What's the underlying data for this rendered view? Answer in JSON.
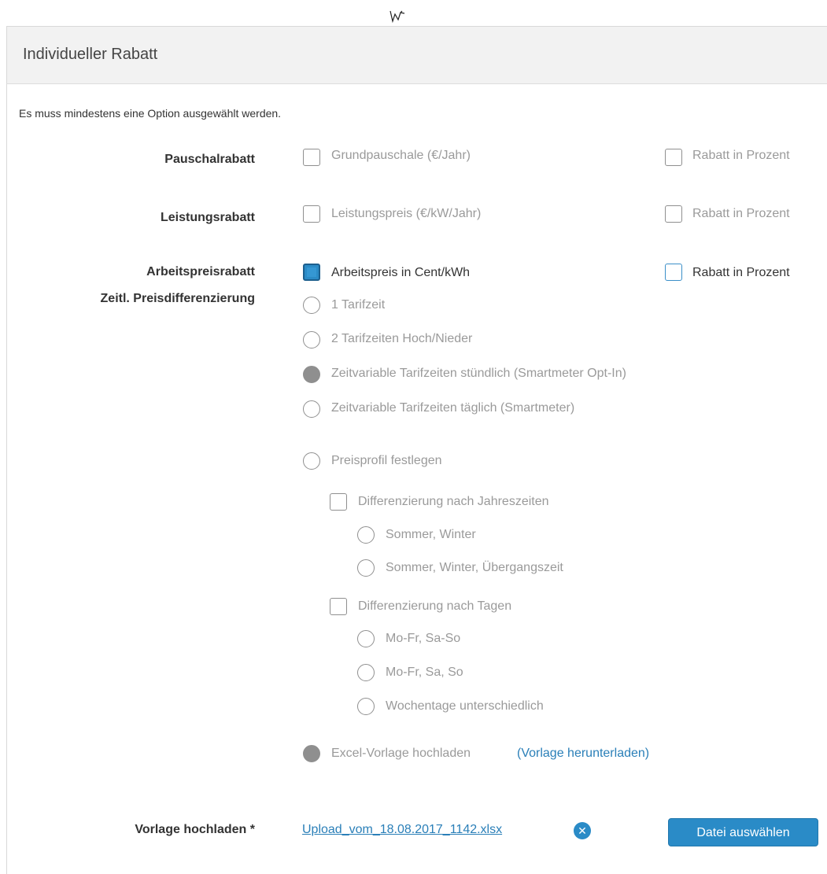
{
  "panel": {
    "title": "Individueller Rabatt",
    "note": "Es muss mindestens eine Option ausgewählt werden."
  },
  "pauschal": {
    "label": "Pauschalrabatt",
    "option1": "Grundpauschale (€/Jahr)",
    "option2": "Rabatt in Prozent"
  },
  "leistung": {
    "label": "Leistungsrabatt",
    "option1": "Leistungspreis (€/kW/Jahr)",
    "option2": "Rabatt in Prozent"
  },
  "arbeitspreis": {
    "label": "Arbeitspreisrabatt",
    "option1": "Arbeitspreis in Cent/kWh",
    "option2": "Rabatt in Prozent"
  },
  "zeitl": {
    "label": "Zeitl. Preisdifferenzierung",
    "options": [
      "1 Tarifzeit",
      "2 Tarifzeiten Hoch/Nieder",
      "Zeitvariable Tarifzeiten stündlich (Smartmeter Opt-In)",
      "Zeitvariable Tarifzeiten täglich (Smartmeter)",
      "Preisprofil festlegen"
    ],
    "jahreszeiten": {
      "label": "Differenzierung nach Jahreszeiten",
      "options": [
        "Sommer, Winter",
        "Sommer, Winter, Übergangszeit"
      ]
    },
    "tage": {
      "label": "Differenzierung nach Tagen",
      "options": [
        "Mo-Fr, Sa-So",
        "Mo-Fr, Sa, So",
        "Wochentage unterschiedlich"
      ]
    },
    "excel": {
      "label": "Excel-Vorlage hochladen",
      "link": "(Vorlage herunterladen)"
    }
  },
  "upload": {
    "label": "Vorlage hochladen *",
    "filename": "Upload_vom_18.08.2017_1142.xlsx",
    "button": "Datei auswählen"
  },
  "icons": {
    "remove": "close-circle-icon",
    "cursor": "mouse-cursor-icon"
  },
  "colors": {
    "accent": "#2a8bc7",
    "header_bg": "#f2f2f2",
    "disabled_text": "#9a9a9a"
  }
}
